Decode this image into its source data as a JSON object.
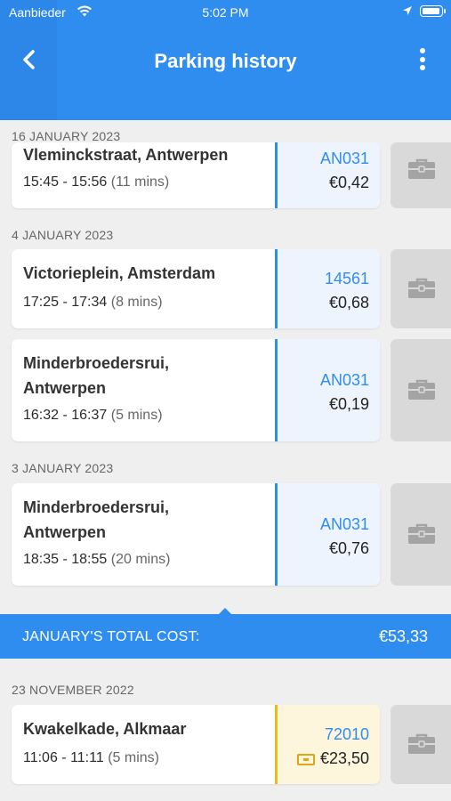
{
  "status_bar": {
    "carrier": "Aanbieder",
    "time": "5:02 PM"
  },
  "header": {
    "title": "Parking history"
  },
  "groups": [
    {
      "date": "16 JANUARY 2023"
    },
    {
      "date": "4 JANUARY 2023"
    },
    {
      "date": "3 JANUARY 2023"
    },
    {
      "date": "23 NOVEMBER 2022"
    }
  ],
  "sessions": [
    {
      "location": "Vleminckstraat, Antwerpen",
      "time_range": "15:45 - 15:56",
      "duration": "(11 mins)",
      "zone": "AN031",
      "cost": "€0,42"
    },
    {
      "location": "Victorieplein, Amsterdam",
      "time_range": "17:25 - 17:34",
      "duration": "(8 mins)",
      "zone": "14561",
      "cost": "€0,68"
    },
    {
      "location_line1": "Minderbroedersrui,",
      "location_line2": "Antwerpen",
      "time_range": "16:32 - 16:37",
      "duration": "(5 mins)",
      "zone": "AN031",
      "cost": "€0,19"
    },
    {
      "location_line1": "Minderbroedersrui,",
      "location_line2": "Antwerpen",
      "time_range": "18:35 - 18:55",
      "duration": "(20 mins)",
      "zone": "AN031",
      "cost": "€0,76"
    },
    {
      "location": "Kwakelkade, Alkmaar",
      "time_range": "11:06 - 11:11",
      "duration": "(5 mins)",
      "zone": "72010",
      "cost": "€23,50"
    }
  ],
  "month_total": {
    "label": "JANUARY'S TOTAL COST:",
    "value": "€53,33"
  },
  "colors": {
    "primary": "#2f8df0",
    "ticket": "#f1b81b",
    "business": "#d9d9d9"
  },
  "icons": {
    "back": "chevron-left-icon",
    "more": "more-vertical-icon",
    "business": "briefcase-icon",
    "ticket": "ticket-icon"
  }
}
